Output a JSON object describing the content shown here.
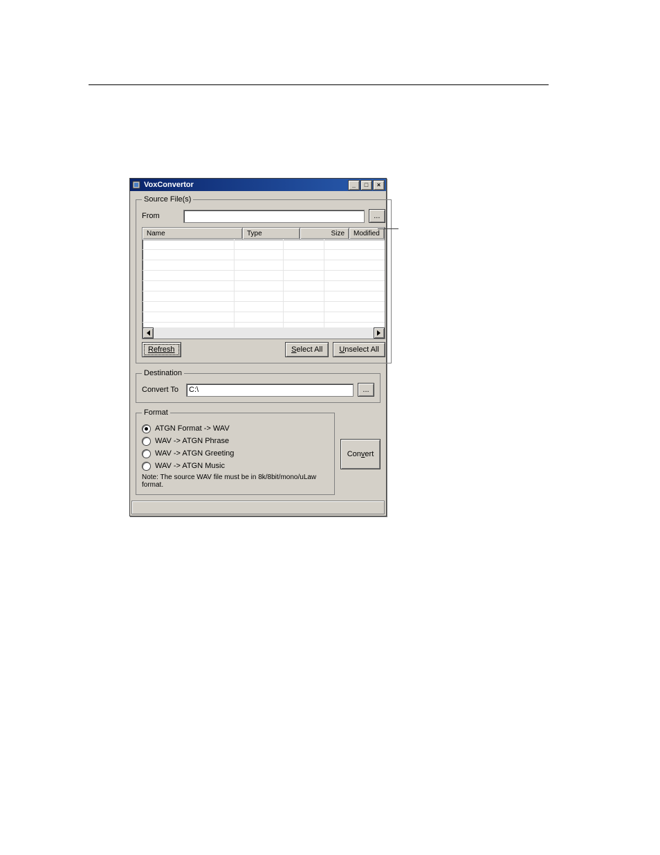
{
  "window": {
    "title": "VoxConvertor",
    "minimize_glyph": "_",
    "maximize_glyph": "□",
    "close_glyph": "×"
  },
  "source": {
    "legend": "Source File(s)",
    "from_label": "From",
    "from_value": "",
    "browse_label": "...",
    "columns": {
      "name": "Name",
      "type": "Type",
      "size": "Size",
      "modified": "Modified"
    },
    "refresh_label": "Refresh",
    "select_all_label": "Select All",
    "select_all_mnemonic": "S",
    "unselect_all_label": "Unselect All",
    "unselect_all_mnemonic": "U",
    "scroll_left_glyph": "◄",
    "scroll_right_glyph": "►"
  },
  "destination": {
    "legend": "Destination",
    "convert_to_label": "Convert To",
    "convert_to_value": "C:\\",
    "browse_label": "..."
  },
  "format": {
    "legend": "Format",
    "options": [
      {
        "label": "ATGN Format -> WAV",
        "checked": true
      },
      {
        "label": "WAV -> ATGN Phrase",
        "checked": false
      },
      {
        "label": "WAV -> ATGN Greeting",
        "checked": false
      },
      {
        "label": "WAV -> ATGN Music",
        "checked": false
      }
    ],
    "note": "Note: The source WAV file must be in 8k/8bit/mono/uLaw format."
  },
  "convert_label": "Convert",
  "convert_mnemonic": "v"
}
